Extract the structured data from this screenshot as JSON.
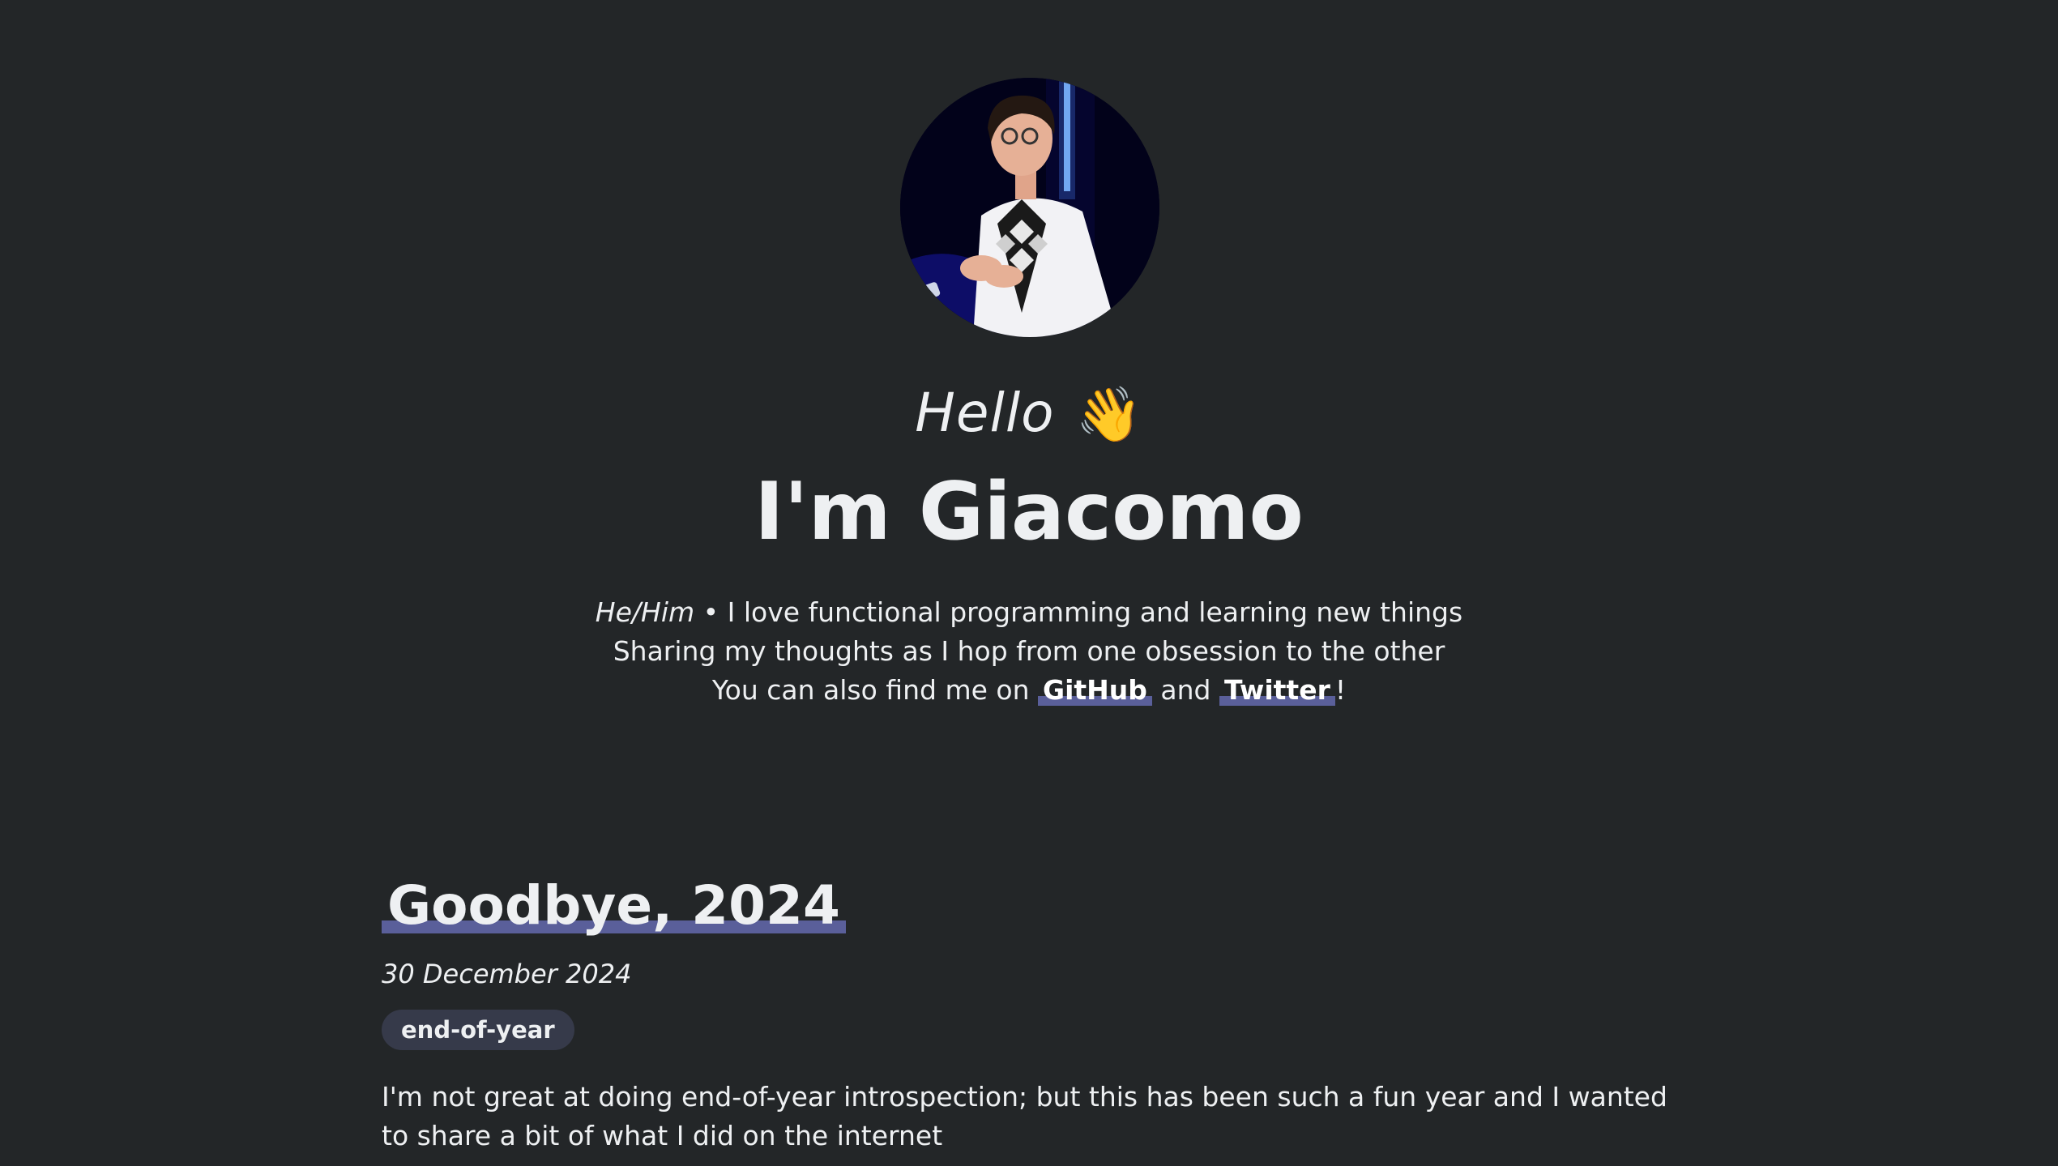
{
  "header": {
    "avatar_alt": "Giacomo",
    "greeting": "Hello",
    "wave_icon": "waving-hand-icon",
    "wave_glyph": "👋",
    "name": "I'm Giacomo"
  },
  "intro": {
    "pronouns": "He/Him",
    "line1_rest": " • I love functional programming and learning new things",
    "line2": "Sharing my thoughts as I hop from one obsession to the other",
    "line3_prefix": "You can also find me on ",
    "github_label": "GitHub",
    "and_text": " and ",
    "twitter_label": "Twitter",
    "line3_suffix": "!"
  },
  "posts": [
    {
      "title": "Goodbye, 2024",
      "date": "30 December 2024",
      "tag": "end-of-year",
      "excerpt": "I'm not great at doing end-of-year introspection; but this has been such a fun year and I wanted to share a bit of what I did on the internet"
    }
  ],
  "colors": {
    "background": "#232628",
    "text": "#eef0f2",
    "highlight": "#5a5f9a",
    "tag_background": "#363a4a"
  }
}
